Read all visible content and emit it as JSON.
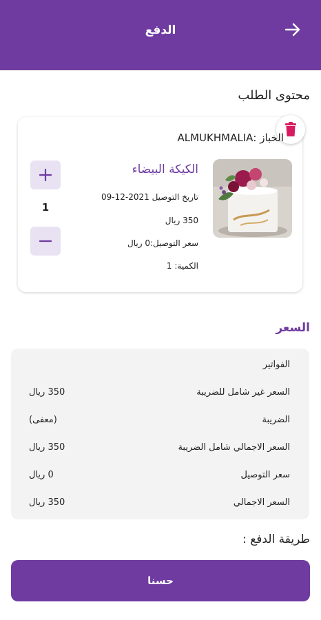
{
  "header": {
    "title": "الدفع"
  },
  "order": {
    "section_title": "محتوى الطلب",
    "baker": "الخباز :ALMUKHMALIA",
    "product_name": "الكيكة البيضاء",
    "delivery_date": "تاريخ التوصيل 2021-12-09",
    "price": "350 ريال",
    "delivery_price": "سعر التوصيل:0 ريال",
    "quantity_label": "الكمية: 1",
    "quantity_value": "1"
  },
  "pricing": {
    "title": "السعر",
    "invoices_label": "الفواتير",
    "rows": [
      {
        "label": "السعر غير شامل للضريبة",
        "value": "350 ريال"
      },
      {
        "label": "الضريبة",
        "value": "(معفى)"
      },
      {
        "label": "السعر الاجمالي شامل الضريبة",
        "value": "350 ريال"
      },
      {
        "label": "سعر التوصيل",
        "value": "0 ريال"
      },
      {
        "label": "السعر الاجمالي",
        "value": "350 ريال"
      }
    ]
  },
  "payment": {
    "title": "طريقة الدفع :"
  },
  "actions": {
    "ok_label": "حسنا"
  },
  "colors": {
    "primary": "#6f3ba1",
    "delete": "#d81b60",
    "qty_bg": "#e9e2f2",
    "box_bg": "#f3f3f3"
  }
}
